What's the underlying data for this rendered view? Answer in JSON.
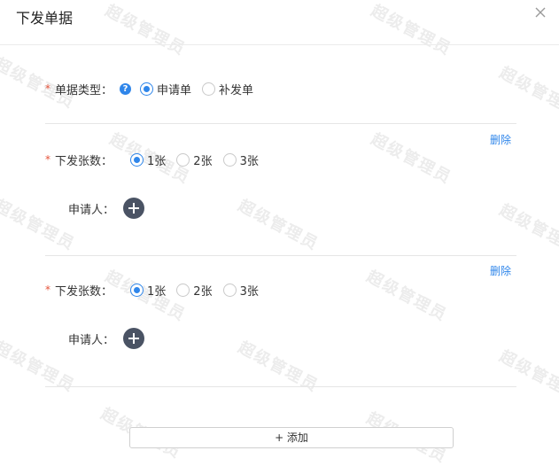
{
  "dialog": {
    "title": "下发单据",
    "close_icon": "close-icon"
  },
  "doc_type": {
    "label": "单据类型：",
    "required_mark": "*",
    "help_glyph": "?",
    "options": [
      {
        "label": "申请单",
        "checked": true
      },
      {
        "label": "补发单",
        "checked": false
      }
    ]
  },
  "groups": [
    {
      "delete_label": "删除",
      "count_label": "下发张数：",
      "required_mark": "*",
      "options": [
        {
          "label": "1张",
          "checked": true
        },
        {
          "label": "2张",
          "checked": false
        },
        {
          "label": "3张",
          "checked": false
        }
      ],
      "applicant_label": "申请人："
    },
    {
      "delete_label": "删除",
      "count_label": "下发张数：",
      "required_mark": "*",
      "options": [
        {
          "label": "1张",
          "checked": true
        },
        {
          "label": "2张",
          "checked": false
        },
        {
          "label": "3张",
          "checked": false
        }
      ],
      "applicant_label": "申请人："
    }
  ],
  "add_button_label": "+ 添加",
  "watermark_text": "超级管理员",
  "colors": {
    "accent": "#2f86ea",
    "required": "#e5533a",
    "add_circle": "#4a5364"
  }
}
